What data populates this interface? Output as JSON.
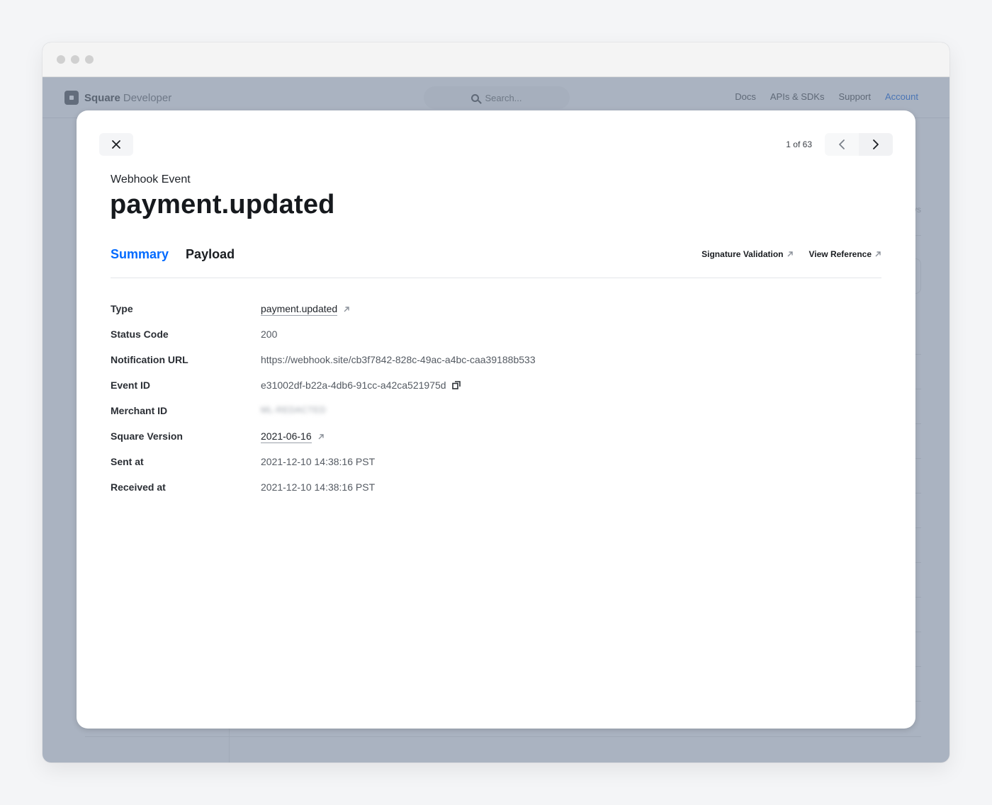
{
  "browser": {
    "window_controls": [
      "close",
      "minimize",
      "maximize"
    ]
  },
  "background_page": {
    "brand": {
      "strong": "Square",
      "light": "Developer",
      "icon": "square-logo-icon"
    },
    "search": {
      "placeholder": "Search...",
      "icon": "search-icon"
    },
    "nav_links": [
      {
        "label": "Docs",
        "active": false
      },
      {
        "label": "APIs & SDKs",
        "active": false
      },
      {
        "label": "Support",
        "active": false
      },
      {
        "label": "Account",
        "active": true
      }
    ],
    "partial_text": "ys"
  },
  "modal": {
    "close_icon": "close-icon",
    "pager": {
      "text": "1 of 63",
      "current": 1,
      "total": 63,
      "prev_icon": "chevron-left-icon",
      "next_icon": "chevron-right-icon"
    },
    "eyebrow": "Webhook Event",
    "title": "payment.updated",
    "tabs": [
      {
        "label": "Summary",
        "active": true
      },
      {
        "label": "Payload",
        "active": false
      }
    ],
    "external_links": [
      {
        "label": "Signature Validation",
        "icon": "external-arrow-icon"
      },
      {
        "label": "View Reference",
        "icon": "external-arrow-icon"
      }
    ],
    "details": [
      {
        "label": "Type",
        "value": "payment.updated",
        "kind": "link"
      },
      {
        "label": "Status Code",
        "value": "200",
        "kind": "text"
      },
      {
        "label": "Notification URL",
        "value": "https://webhook.site/cb3f7842-828c-49ac-a4bc-caa39188b533",
        "kind": "text"
      },
      {
        "label": "Event ID",
        "value": "e31002df-b22a-4db6-91cc-a42ca521975d",
        "kind": "copy"
      },
      {
        "label": "Merchant ID",
        "value": "ML-REDACTED",
        "kind": "blurred"
      },
      {
        "label": "Square Version",
        "value": "2021-06-16",
        "kind": "link"
      },
      {
        "label": "Sent at",
        "value": "2021-12-10 14:38:16 PST",
        "kind": "text"
      },
      {
        "label": "Received at",
        "value": "2021-12-10 14:38:16 PST",
        "kind": "text"
      }
    ]
  },
  "colors": {
    "accent": "#006aff",
    "overlay": "#aab3c1",
    "account_link": "#4a75b5"
  }
}
